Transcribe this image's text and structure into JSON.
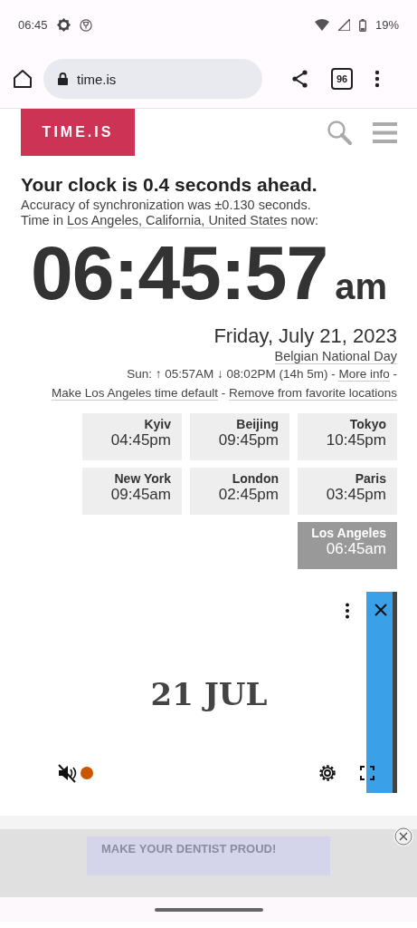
{
  "status_bar": {
    "time": "06:45",
    "battery": "19%"
  },
  "browser": {
    "url": "time.is",
    "tab_count": "96"
  },
  "header": {
    "logo": "TIME.IS"
  },
  "headline": "Your clock is 0.4 seconds ahead.",
  "accuracy": "Accuracy of synchronization was ±0.130 seconds.",
  "location_line": {
    "prefix": "Time in",
    "link": "Los Angeles, California, United States",
    "suffix": "now:"
  },
  "clock": {
    "time": "06:45:57",
    "period": "am"
  },
  "date": "Friday, July 21, 2023",
  "holiday": "Belgian National Day",
  "sun_line": {
    "text": "Sun: ↑ 05:57AM ↓ 08:02PM (14h 5m)",
    "separator": "-",
    "links": [
      "More info",
      "Make Los Angeles time default",
      "Remove from favorite locations"
    ]
  },
  "clocks": [
    {
      "city": "Kyiv",
      "time": "04:45pm",
      "selected": false
    },
    {
      "city": "Beijing",
      "time": "09:45pm",
      "selected": false
    },
    {
      "city": "Tokyo",
      "time": "10:45pm",
      "selected": false
    },
    {
      "city": "New York",
      "time": "09:45am",
      "selected": false
    },
    {
      "city": "London",
      "time": "02:45pm",
      "selected": false
    },
    {
      "city": "Paris",
      "time": "03:45pm",
      "selected": false
    },
    {
      "city": "Los Angeles",
      "time": "06:45am",
      "selected": true
    }
  ],
  "video_ad": {
    "caption": "21 JUL"
  },
  "banner_ad": {
    "text": "MAKE YOUR DENTIST PROUD!"
  }
}
